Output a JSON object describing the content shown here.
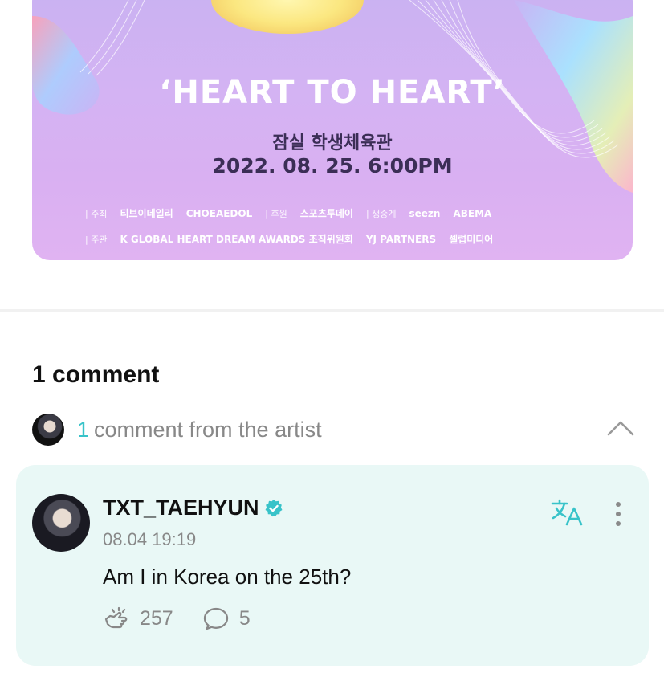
{
  "poster": {
    "title": "‘HEART TO HEART’",
    "venue": "잠실 학생체육관",
    "date": "2022. 08. 25. 6:00PM",
    "credits_row1": [
      {
        "role": "| 주최",
        "names": [
          "티브이데일리",
          "CHOEAEDOL"
        ]
      },
      {
        "role": "| 후원",
        "names": [
          "스포츠투데이"
        ]
      },
      {
        "role": "| 생중계",
        "names": [
          "seezn",
          "ABEMA"
        ]
      }
    ],
    "credits_row2": [
      {
        "role": "| 주관",
        "names": [
          "K GLOBAL HEART DREAM AWARDS 조직위원회",
          "YJ PARTNERS",
          "셀럽미디어"
        ]
      }
    ]
  },
  "comments": {
    "count_label": "1 comment",
    "artist_count": "1",
    "artist_label": "comment from the artist"
  },
  "comment": {
    "username": "TXT_TAEHYUN",
    "timestamp": "08.04 19:19",
    "text": "Am I in Korea on the 25th?",
    "likes": "257",
    "replies": "5"
  },
  "colors": {
    "accent": "#38c3c9",
    "card_bg": "#e9f8f6",
    "poster_bg": "#d4b3f3"
  },
  "icons": {
    "verified": "verified-badge-icon",
    "translate": "translate-icon",
    "more": "more-vertical-icon",
    "like": "like-hand-icon",
    "reply": "reply-bubble-icon",
    "collapse": "chevron-up-icon"
  }
}
